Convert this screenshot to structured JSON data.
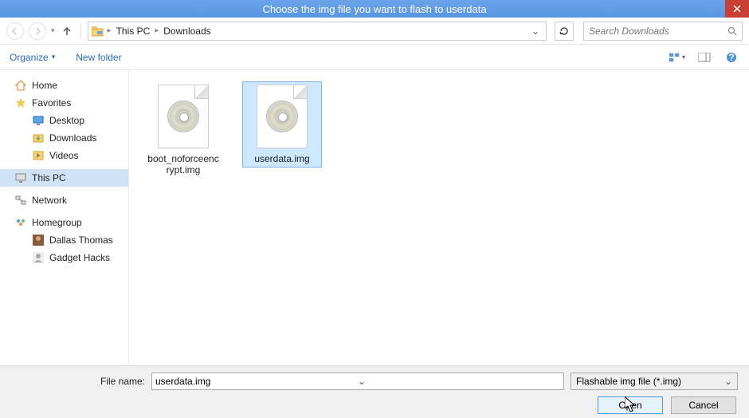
{
  "titlebar": {
    "title": "Choose the img file you want to flash to userdata"
  },
  "nav": {
    "crumb1": "This PC",
    "crumb2": "Downloads"
  },
  "search": {
    "placeholder": "Search Downloads"
  },
  "toolbar": {
    "organize": "Organize",
    "newfolder": "New folder"
  },
  "sidebar": {
    "home": "Home",
    "favorites": "Favorites",
    "desktop": "Desktop",
    "downloads": "Downloads",
    "videos": "Videos",
    "thispc": "This PC",
    "network": "Network",
    "homegroup": "Homegroup",
    "user1": "Dallas Thomas",
    "user2": "Gadget Hacks"
  },
  "files": {
    "file1": "boot_noforceencrypt.img",
    "file2": "userdata.img"
  },
  "bottom": {
    "fnlabel": "File name:",
    "fnvalue": "userdata.img",
    "filter": "Flashable img file (*.img)",
    "open": "Open",
    "cancel": "Cancel"
  }
}
